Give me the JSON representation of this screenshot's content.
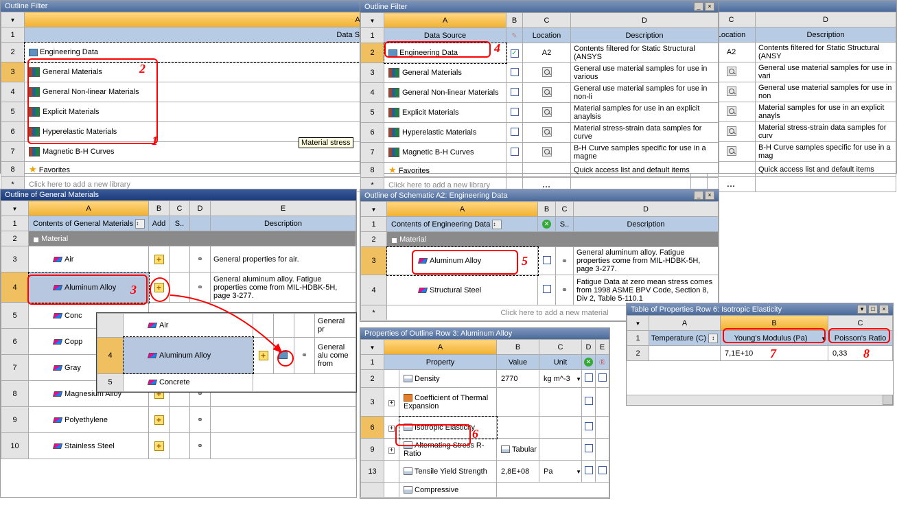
{
  "panels": {
    "filter_left": {
      "title": "Outline Filter",
      "cols": {
        "A": "A",
        "B": "B",
        "C": "C",
        "D": "D",
        "rowA": "Data Source",
        "rowC": "Location",
        "rowD": "Description"
      },
      "rows": [
        {
          "n": "2",
          "name": "Engineering Data",
          "loc": "A2",
          "desc": "Contents filtered for Static Structural (ANSY",
          "check": true,
          "mag": false,
          "ed_icon": true
        },
        {
          "n": "3",
          "name": "General Materials",
          "loc": "",
          "desc": "General use material samples for use in vari",
          "check": true,
          "mag": true
        },
        {
          "n": "4",
          "name": "General Non-linear Materials",
          "loc": "",
          "desc": "General use material samples for use in non",
          "check": true,
          "mag": true
        },
        {
          "n": "5",
          "name": "Explicit Materials",
          "loc": "",
          "desc": "Material samples for use in an explicit anayls",
          "check": true,
          "mag": true
        },
        {
          "n": "6",
          "name": "Hyperelastic Materials",
          "loc": "",
          "desc": "Material stress-strain data samples for curv",
          "check": true,
          "mag": true
        },
        {
          "n": "7",
          "name": "Magnetic B-H Curves",
          "loc": "",
          "desc": "B-H Curve samples specific for use in a mag",
          "check": true,
          "mag": true
        },
        {
          "n": "8",
          "name": "Favorites",
          "loc": "",
          "desc": "Quick access list and default items",
          "fav": true
        }
      ],
      "addnew": "Click here to add a new library",
      "tooltip": "Material stress"
    },
    "filter_right": {
      "title": "Outline Filter",
      "rows": [
        {
          "n": "2",
          "name": "Engineering Data",
          "loc": "A2",
          "desc": "Contents filtered for Static Structural (ANSYS",
          "check": true
        },
        {
          "n": "3",
          "name": "General Materials",
          "loc": "",
          "desc": "General use material samples for use in various",
          "check": false,
          "mag": true
        },
        {
          "n": "4",
          "name": "General Non-linear Materials",
          "loc": "",
          "desc": "General use material samples for use in non-li",
          "check": false,
          "mag": true
        },
        {
          "n": "5",
          "name": "Explicit Materials",
          "loc": "",
          "desc": "Material samples for use in an explicit anaylsis",
          "check": false,
          "mag": true
        },
        {
          "n": "6",
          "name": "Hyperelastic Materials",
          "loc": "",
          "desc": "Material stress-strain data samples for curve",
          "check": false,
          "mag": true
        },
        {
          "n": "7",
          "name": "Magnetic B-H Curves",
          "loc": "",
          "desc": "B-H Curve samples specific for use in a magne",
          "check": false,
          "mag": true
        },
        {
          "n": "8",
          "name": "Favorites",
          "loc": "",
          "desc": "Quick access list and default items",
          "fav": true
        }
      ]
    },
    "general_mat": {
      "title": "Outline of General Materials",
      "hdr": {
        "A": "Contents of General Materials",
        "B": "Add",
        "C": "S..",
        "D": "",
        "E": "Description"
      },
      "mat": "Material",
      "rows": [
        {
          "n": "3",
          "name": "Air",
          "desc": "General properties for air."
        },
        {
          "n": "4",
          "name": "Aluminum Alloy",
          "desc": "General aluminum alloy. Fatigue properties come from MIL-HDBK-5H, page 3-277.",
          "sel": true
        },
        {
          "n": "5",
          "name": "Conc"
        },
        {
          "n": "6",
          "name": "Copp"
        },
        {
          "n": "7",
          "name": "Gray"
        },
        {
          "n": "8",
          "name": "Magnesium Alloy"
        },
        {
          "n": "9",
          "name": "Polyethylene"
        },
        {
          "n": "10",
          "name": "Stainless Steel"
        }
      ]
    },
    "eng_data": {
      "title": "Outline of Schematic A2: Engineering Data",
      "hdr": {
        "A": "Contents of Engineering Data",
        "C": "S..",
        "D": "Description"
      },
      "mat": "Material",
      "rows": [
        {
          "n": "3",
          "name": "Aluminum Alloy",
          "desc": "General aluminum alloy. Fatigue properties come from MIL-HDBK-5H, page 3-277."
        },
        {
          "n": "4",
          "name": "Structural Steel",
          "desc": "Fatigue Data at zero mean stress comes from 1998 ASME BPV Code, Section 8, Div 2, Table 5-110.1"
        }
      ],
      "addnew": "Click here to add a new material"
    },
    "props": {
      "title": "Properties of Outline Row 3: Aluminum Alloy",
      "hdr": {
        "A": "Property",
        "B": "Value",
        "C": "Unit",
        "D": "",
        "E": ""
      },
      "rows": [
        {
          "n": "2",
          "name": "Density",
          "val": "2770",
          "unit": "kg m^-3",
          "ic": "t"
        },
        {
          "n": "3",
          "name": "Coefficient of Thermal Expansion",
          "val": "",
          "unit": "",
          "exp": true,
          "ic": "b"
        },
        {
          "n": "6",
          "name": "Isotropic Elasticity",
          "val": "",
          "unit": "",
          "exp": true,
          "sel": true,
          "ic": "t"
        },
        {
          "n": "9",
          "name": "Alternating Stress R-Ratio",
          "val": "Tabular",
          "unit": "",
          "exp": true,
          "tab": true,
          "ic": "t"
        },
        {
          "n": "13",
          "name": "Tensile Yield Strength",
          "val": "2,8E+08",
          "unit": "Pa",
          "ic": "t"
        },
        {
          "n": "",
          "name": "Compressive",
          "val": "",
          "unit": "",
          "ic": "t",
          "partial": true
        }
      ]
    },
    "tableprops": {
      "title": "Table of Properties Row 6: Isotropic Elasticity",
      "hdr": {
        "A": "Temperature (C)",
        "B": "Young's Modulus (Pa)",
        "C": "Poisson's Ratio"
      },
      "row": {
        "n": "2",
        "A": "",
        "B": "7,1E+10",
        "C": "0,33"
      }
    },
    "inset": {
      "rows": [
        {
          "n": "",
          "name": "Air",
          "desc": "General pr",
          "partial_top": true
        },
        {
          "n": "4",
          "name": "Aluminum Alloy",
          "desc": "General alu come from",
          "sel": true
        },
        {
          "n": "5",
          "name": "Concrete",
          "partial": true
        }
      ]
    }
  },
  "callouts": {
    "1": "1",
    "2": "2",
    "3": "3",
    "4": "4",
    "5": "5",
    "6": "6",
    "7": "7",
    "8": "8"
  }
}
